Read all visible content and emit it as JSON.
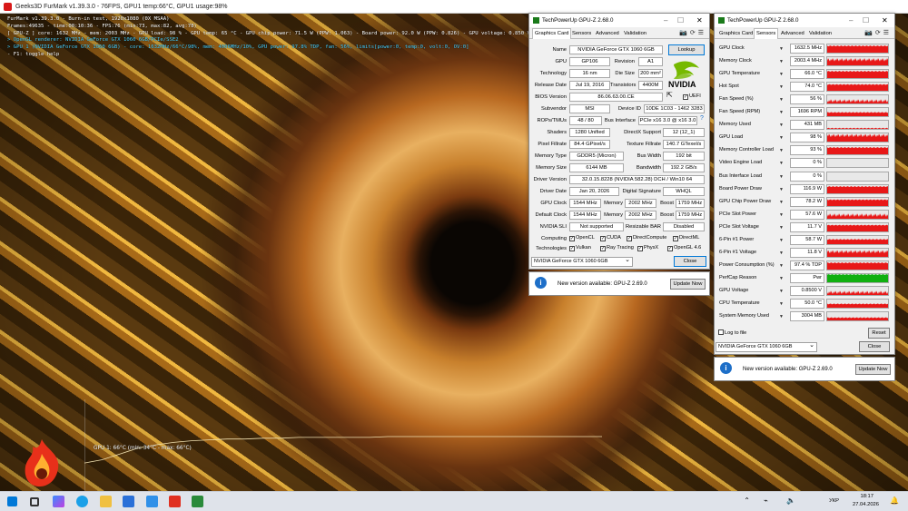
{
  "furmark": {
    "title": "Geeks3D FurMark v1.39.3.0 - 76FPS, GPU1 temp:66°C, GPU1 usage:98%",
    "overlay": [
      "FurMark v1.39.3.0 - Burn-in test, 1920x1080 (0X MSAA)",
      "Frames:49635 - time:00:10:36 - FPS:76 (min:73, max:82, avg:78)",
      "[ GPU-Z ] core: 1632 MHz - mem: 2003 MHz - GPU load: 98 % - GPU temp: 65 °C - GPU chip power: 71.5 W (PPW: 1.063) - Board power: 92.0 W (PPW: 0.826) - GPU voltage: 0.850 V",
      "> OpenGL renderer: NVIDIA GeForce GTX 1060 6GB/PCIe/SSE2",
      "> GPU 1 (NVIDIA GeForce GTX 1060 6GB) - core: 1632MHz/66°C/98%, mem: 4006MHz/10%, GPU power: 97.8% TDP, fan: 56%, limits[power:0, temp:0, volt:0, OV:0]",
      "- F1: toggle help"
    ],
    "graph_label": "GPU 1: 66°C (min: 34°C - max: 66°C)",
    "graph_data": {
      "temps_c": [
        34,
        38,
        45,
        52,
        56,
        59,
        61,
        62,
        63,
        63,
        64,
        64,
        65,
        65,
        65,
        65,
        65,
        66,
        66,
        66,
        66,
        66,
        66,
        66,
        66,
        66,
        66,
        66,
        66,
        66
      ]
    }
  },
  "gpuz1": {
    "title": "TechPowerUp GPU-Z 2.68.0",
    "tabs": [
      "Graphics Card",
      "Sensors",
      "Advanced",
      "Validation"
    ],
    "lookup": "Lookup",
    "uefi": "UEFI",
    "rows": {
      "name": {
        "label": "Name",
        "value": "NVIDIA GeForce GTX 1060 6GB"
      },
      "gpu": {
        "label": "GPU",
        "value": "GP106"
      },
      "revision": {
        "label": "Revision",
        "value": "A1"
      },
      "technology": {
        "label": "Technology",
        "value": "16 nm"
      },
      "die_size": {
        "label": "Die Size",
        "value": "200 mm²"
      },
      "release": {
        "label": "Release Date",
        "value": "Jul 19, 2016"
      },
      "transistors": {
        "label": "Transistors",
        "value": "4400M"
      },
      "bios": {
        "label": "BIOS Version",
        "value": "86.06.63.00.CE"
      },
      "subvendor": {
        "label": "Subvendor",
        "value": "MSI"
      },
      "device_id": {
        "label": "Device ID",
        "value": "10DE 1C03 - 1462 3283"
      },
      "rops": {
        "label": "ROPs/TMUs",
        "value": "48 / 80"
      },
      "bus_interface": {
        "label": "Bus Interface",
        "value": "PCIe x16 3.0 @ x16 3.0"
      },
      "shaders": {
        "label": "Shaders",
        "value": "1280 Unified"
      },
      "directx": {
        "label": "DirectX Support",
        "value": "12 (12_1)"
      },
      "pixel_fill": {
        "label": "Pixel Fillrate",
        "value": "84.4 GPixel/s"
      },
      "texture_fill": {
        "label": "Texture Fillrate",
        "value": "140.7 GTexel/s"
      },
      "mem_type": {
        "label": "Memory Type",
        "value": "GDDR5 (Micron)"
      },
      "bus_width": {
        "label": "Bus Width",
        "value": "192 bit"
      },
      "mem_size": {
        "label": "Memory Size",
        "value": "6144 MB"
      },
      "bandwidth": {
        "label": "Bandwidth",
        "value": "192.2 GB/s"
      },
      "driver_version": {
        "label": "Driver Version",
        "value": "32.0.15.8228 (NVIDIA 582.28) DCH / Win10 64"
      },
      "driver_date": {
        "label": "Driver Date",
        "value": "Jan 20, 2026"
      },
      "digital_sig": {
        "label": "Digital Signature",
        "value": "WHQL"
      },
      "gpu_clock": {
        "label": "GPU Clock",
        "value": "1544 MHz",
        "mem_label": "Memory",
        "mem": "2002 MHz",
        "boost_label": "Boost",
        "boost": "1759 MHz"
      },
      "default_clock": {
        "label": "Default Clock",
        "value": "1544 MHz",
        "mem_label": "Memory",
        "mem": "2002 MHz",
        "boost_label": "Boost",
        "boost": "1759 MHz"
      },
      "sli": {
        "label": "NVIDIA SLI",
        "value": "Not supported"
      },
      "resizable_bar": {
        "label": "Resizable BAR",
        "value": "Disabled"
      },
      "computing": {
        "label": "Computing",
        "items": [
          "OpenCL",
          "CUDA",
          "DirectCompute",
          "DirectML"
        ]
      },
      "technologies": {
        "label": "Technologies",
        "items": [
          "Vulkan",
          "Ray Tracing",
          "PhysX",
          "OpenGL 4.6"
        ]
      }
    },
    "gpu_select": "NVIDIA GeForce GTX 1060 6GB",
    "close": "Close",
    "notif_text": "New version available: GPU-Z 2.69.0",
    "update": "Update Now"
  },
  "gpuz2": {
    "title": "TechPowerUp GPU-Z 2.68.0",
    "tabs": [
      "Graphics Card",
      "Sensors",
      "Advanced",
      "Validation"
    ],
    "sensors": [
      {
        "label": "GPU Clock",
        "value": "1632.5 MHz",
        "level": 0.9
      },
      {
        "label": "Memory Clock",
        "value": "2003.4 MHz",
        "level": 0.9
      },
      {
        "label": "GPU Temperature",
        "value": "66.0 °C",
        "level": 0.9
      },
      {
        "label": "Hot Spot",
        "value": "74.0 °C",
        "level": 0.85
      },
      {
        "label": "Fan Speed (%)",
        "value": "56 %",
        "level": 0.6
      },
      {
        "label": "Fan Speed (RPM)",
        "value": "1696 RPM",
        "level": 0.6
      },
      {
        "label": "Memory Used",
        "value": "431 MB",
        "level": 0.3
      },
      {
        "label": "GPU Load",
        "value": "98 %",
        "level": 0.95
      },
      {
        "label": "Memory Controller Load",
        "value": "93 %",
        "level": 0.9
      },
      {
        "label": "Video Engine Load",
        "value": "0 %",
        "level": 0
      },
      {
        "label": "Bus Interface Load",
        "value": "0 %",
        "level": 0
      },
      {
        "label": "Board Power Draw",
        "value": "116.9 W",
        "level": 0.9
      },
      {
        "label": "GPU Chip Power Draw",
        "value": "78.2 W",
        "level": 0.85
      },
      {
        "label": "PCIe Slot Power",
        "value": "57.6 W",
        "level": 0.7
      },
      {
        "label": "PCIe Slot Voltage",
        "value": "11.7 V",
        "level": 0.85
      },
      {
        "label": "6-Pin #1 Power",
        "value": "58.7 W",
        "level": 0.7
      },
      {
        "label": "6-Pin #1 Voltage",
        "value": "11.8 V",
        "level": 0.85
      },
      {
        "label": "Power Consumption (%)",
        "value": "97.4 % TDP",
        "level": 0.9
      },
      {
        "label": "PerfCap Reason",
        "value": "Pwr",
        "level": 1,
        "green": true
      },
      {
        "label": "GPU Voltage",
        "value": "0.8500 V",
        "level": 0.6
      },
      {
        "label": "CPU Temperature",
        "value": "50.0 °C",
        "level": 0.6
      },
      {
        "label": "System Memory Used",
        "value": "3004 MB",
        "level": 0.5
      }
    ],
    "log_label": "Log to file",
    "reset": "Reset",
    "gpu_select": "NVIDIA GeForce GTX 1060 6GB",
    "close": "Close",
    "notif_text": "New version available: GPU-Z 2.69.0",
    "update": "Update Now"
  },
  "taskbar": {
    "lang": "УКР",
    "time": "18:17",
    "date": "27.04.2026"
  },
  "colors": {
    "sensor_red": "#e81818",
    "sensor_green": "#10b010",
    "accent": "#0078d7"
  }
}
